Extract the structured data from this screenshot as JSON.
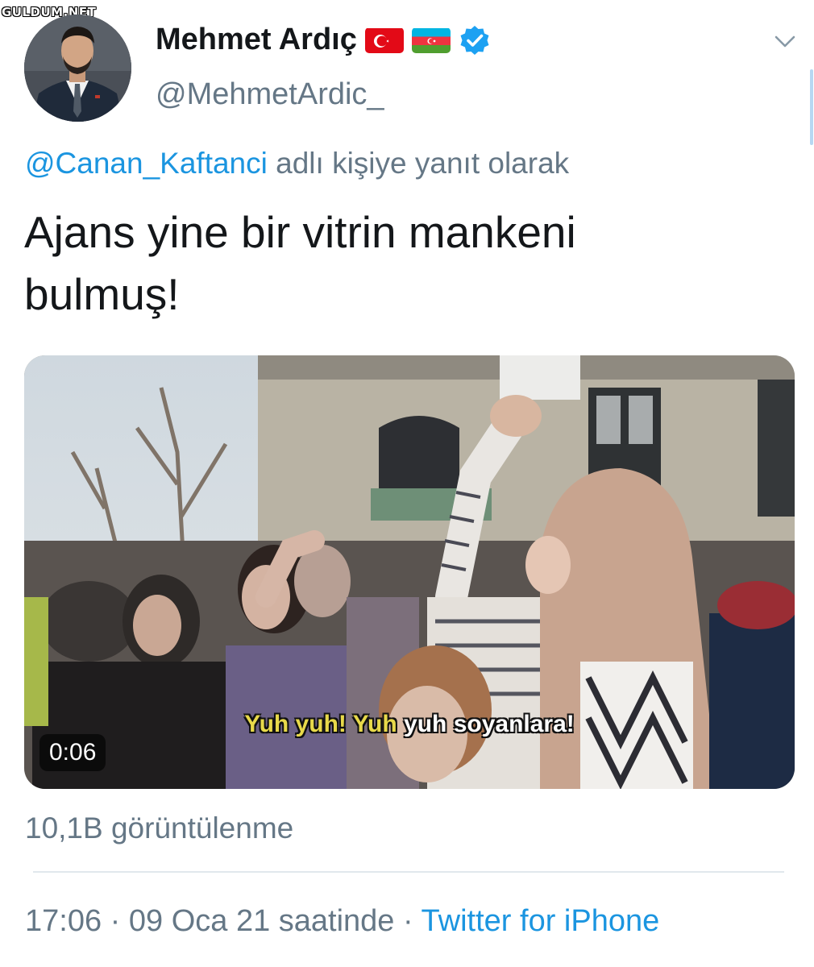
{
  "watermark": "GULDUM.NET",
  "author": {
    "display_name": "Mehmet Ardıç",
    "handle": "@MehmetArdic_",
    "flags": [
      "turkey-flag",
      "azerbaijan-flag"
    ],
    "verified": true
  },
  "reply": {
    "mention": "@Canan_Kaftanci",
    "suffix": "adlı kişiye yanıt olarak"
  },
  "tweet": {
    "text_line1": "Ajans yine bir vitrin mankeni",
    "text_line2": "bulmuş!"
  },
  "media": {
    "type": "video",
    "duration": "0:06",
    "subtitle_highlight": "Yuh yuh! Yuh",
    "subtitle_rest": "yuh soyanlara!"
  },
  "stats": {
    "views": "10,1B görüntülenme"
  },
  "meta": {
    "time": "17:06",
    "separator1": "·",
    "date": "09 Oca 21 saatinde",
    "separator2": "·",
    "source": "Twitter for iPhone"
  },
  "colors": {
    "link": "#1b95e0",
    "secondary_text": "#657786",
    "primary_text": "#14171a",
    "verified_badge": "#1da1f2",
    "divider": "#e1e8ed"
  }
}
